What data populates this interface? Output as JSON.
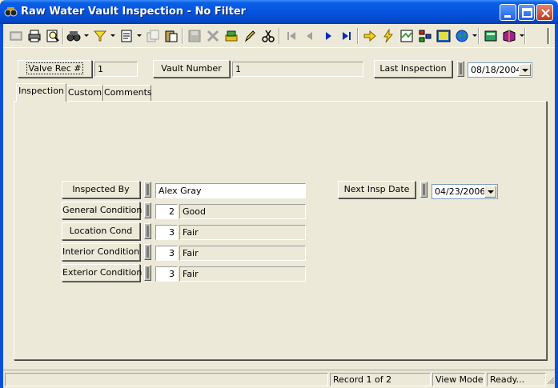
{
  "window": {
    "title": "Raw Water Vault Inspection - No Filter"
  },
  "header": {
    "valve_rec_label": "Valve Rec #",
    "valve_rec_value": "1",
    "vault_number_label": "Vault Number",
    "vault_number_value": "1",
    "last_inspection_label": "Last Inspection",
    "last_inspection_value": "08/18/2004"
  },
  "tabs": [
    {
      "label": "Inspection",
      "active": true
    },
    {
      "label": "Custom",
      "active": false
    },
    {
      "label": "Comments",
      "active": false
    }
  ],
  "inspection": {
    "inspected_by_label": "Inspected By",
    "inspected_by_value": "Alex Gray",
    "general_condition_label": "General Condition",
    "general_condition_code": "2",
    "general_condition_text": "Good",
    "location_cond_label": "Location Cond",
    "location_cond_code": "3",
    "location_cond_text": "Fair",
    "interior_condition_label": "Interior Condition",
    "interior_condition_code": "3",
    "interior_condition_text": "Fair",
    "exterior_condition_label": "Exterior Condition",
    "exterior_condition_code": "3",
    "exterior_condition_text": "Fair",
    "next_insp_date_label": "Next Insp Date",
    "next_insp_date_value": "04/23/2006"
  },
  "status": {
    "record": "Record 1 of 2",
    "mode": "View Mode",
    "state": "Ready..."
  },
  "colors": {
    "titlebar": "#0554e0",
    "face": "#ece9d8",
    "accent_arrow": "#0a2ab8"
  },
  "toolbar_icons": [
    "new-record-icon",
    "print-icon",
    "print-preview-icon",
    "binoculars-find-icon",
    "filter-icon",
    "report-icon",
    "copy-record-icon",
    "paste-record-icon",
    "save-icon",
    "delete-icon",
    "attach-icon",
    "edit-icon",
    "cut-icon",
    "first-record-icon",
    "previous-record-icon",
    "next-record-icon",
    "last-record-icon",
    "go-to-icon",
    "lightning-icon",
    "map-icon",
    "tree-icon",
    "chart-icon",
    "globe-icon",
    "calculator-icon",
    "book-icon"
  ]
}
